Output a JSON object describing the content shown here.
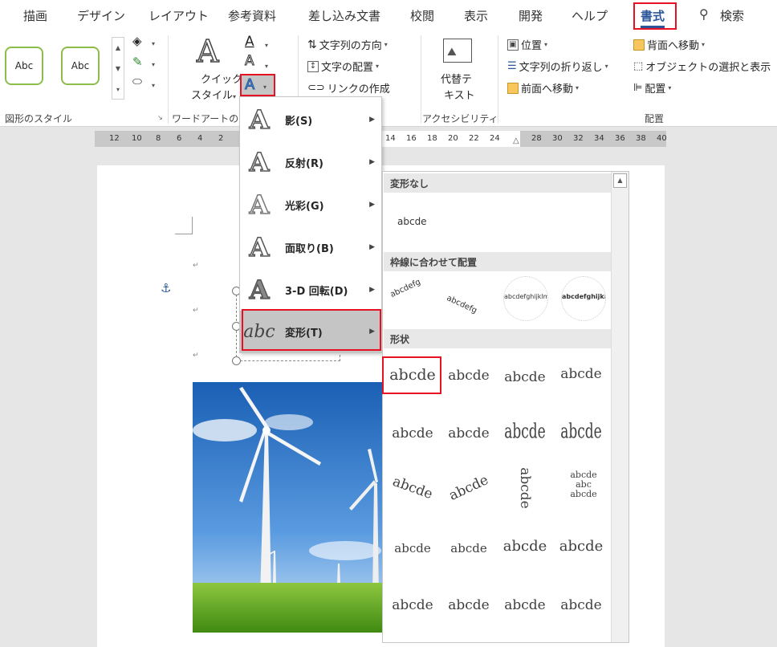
{
  "tabs": [
    "描画",
    "デザイン",
    "レイアウト",
    "参考資料",
    "差し込み文書",
    "校閲",
    "表示",
    "開発",
    "ヘルプ",
    "書式",
    "検索"
  ],
  "ribbon": {
    "shape_style_sample": "Abc",
    "group_shape_styles": "図形のスタイル",
    "quick_style": "クイック",
    "quick_style2": "スタイル",
    "group_wordart": "ワードアートの",
    "text_direction": "文字列の方向",
    "text_align": "文字の配置",
    "create_link": "リンクの作成",
    "alt_text1": "代替テ",
    "alt_text2": "キスト",
    "group_accessibility": "アクセシビリティ",
    "position": "位置",
    "wrap_text": "文字列の折り返し",
    "bring_forward": "前面へ移動",
    "send_backward": "背面へ移動",
    "selection_pane": "オブジェクトの選択と表示",
    "align": "配置",
    "group_arrange": "配置"
  },
  "ruler_numbers": [
    "12",
    "10",
    "8",
    "6",
    "4",
    "2",
    "14",
    "16",
    "18",
    "20",
    "22",
    "24",
    "28",
    "30",
    "32",
    "34",
    "36",
    "38",
    "40"
  ],
  "effects_menu": [
    {
      "label": "影(S)",
      "icon": "text-shadow-icon"
    },
    {
      "label": "反射(R)",
      "icon": "text-reflection-icon"
    },
    {
      "label": "光彩(G)",
      "icon": "text-glow-icon"
    },
    {
      "label": "面取り(B)",
      "icon": "text-bevel-icon"
    },
    {
      "label": "3-D 回転(D)",
      "icon": "text-3d-rotation-icon"
    },
    {
      "label": "変形(T)",
      "icon": "text-transform-icon"
    }
  ],
  "transform_gallery": {
    "section_none": "変形なし",
    "none_sample": "abcde",
    "section_path": "枠線に合わせて配置",
    "path_samples": [
      "abcdefg",
      "abcdefg",
      "abcdefghijklm",
      "abcdefghijklmno"
    ],
    "section_warp": "形状",
    "warp_samples": [
      "abcde",
      "abcde",
      "abcde",
      "abcde",
      "abcde",
      "abcde",
      "abcde",
      "abcde",
      "abcde",
      "abcde",
      "abcde",
      "abc",
      "abcde",
      "abcde",
      "abcde",
      "abcde",
      "abcde",
      "abcde",
      "abcde",
      "abcde"
    ]
  },
  "colors": {
    "accent": "#2b579a",
    "highlight": "#e81123",
    "menu_selected": "#c5c5c5"
  }
}
